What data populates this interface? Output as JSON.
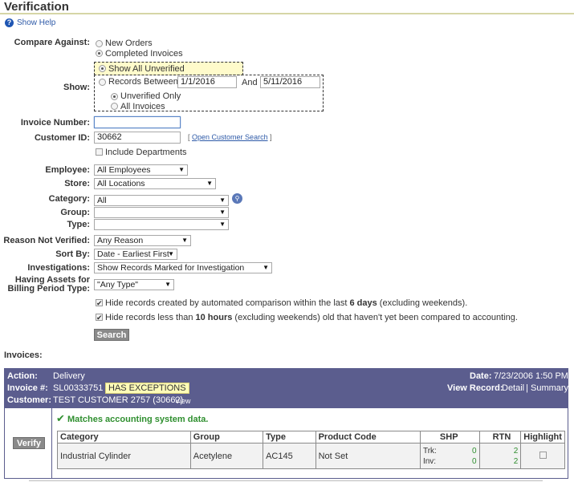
{
  "page": {
    "title": "Verification",
    "help_link": "Show Help",
    "help_icon": "question-icon"
  },
  "form": {
    "compare_label": "Compare Against:",
    "compare_options": [
      "New Orders",
      "Completed Invoices"
    ],
    "compare_selected": "Completed Invoices",
    "show_label": "Show:",
    "show_all_unverified": "Show All Unverified",
    "records_between": "Records Between:",
    "date_from": "1/1/2016",
    "date_and": "And",
    "date_to": "5/11/2016",
    "unverified_only": "Unverified Only",
    "all_invoices": "All Invoices",
    "invoice_number_label": "Invoice Number:",
    "invoice_number_value": "",
    "customer_id_label": "Customer ID:",
    "customer_id_value": "30662",
    "open_customer_search_pre": "[",
    "open_customer_search": "Open Customer Search",
    "open_customer_search_post": "]",
    "include_departments": "Include Departments",
    "employee_label": "Employee:",
    "employee_value": "All Employees",
    "store_label": "Store:",
    "store_value": "All Locations",
    "category_label": "Category:",
    "category_value": "All",
    "group_label": "Group:",
    "group_value": "",
    "type_label": "Type:",
    "type_value": "",
    "reason_label": "Reason Not Verified:",
    "reason_value": "Any Reason",
    "sort_label": "Sort By:",
    "sort_value": "Date - Earliest First",
    "investigations_label": "Investigations:",
    "investigations_value": "Show Records Marked for Investigation",
    "assets_label_1": "Having Assets for",
    "assets_label_2": "Billing Period Type:",
    "assets_value": "\"Any Type\"",
    "hide1_pre": "Hide records created by automated comparison within the last ",
    "hide1_bold": "6 days",
    "hide1_post": " (excluding weekends).",
    "hide2_pre": "Hide records less than ",
    "hide2_bold": "10 hours",
    "hide2_post": " (excluding weekends) old that haven't yet been compared to accounting.",
    "search_button": "Search"
  },
  "invoices": {
    "section_title": "Invoices:",
    "action_label": "Action:",
    "action_value": "Delivery",
    "invoice_label": "Invoice #:",
    "invoice_value": "SL00333751",
    "exceptions_badge": "HAS EXCEPTIONS",
    "customer_label": "Customer:",
    "customer_value": "TEST CUSTOMER 2757 (30662)",
    "view_link": "View",
    "date_label": "Date:",
    "date_value": "7/23/2006 1:50 PM",
    "view_record_label": "View Record:",
    "detail_link": "Detail",
    "separator": "|",
    "summary_link": "Summary",
    "verify_button": "Verify",
    "match_text": "Matches accounting system data.",
    "columns": [
      "Category",
      "Group",
      "Type",
      "Product Code",
      "SHP",
      "RTN",
      "Highlight"
    ],
    "row": {
      "category": "Industrial Cylinder",
      "group": "Acetylene",
      "type": "AC145",
      "product_code": "Not Set",
      "trk_label": "Trk:",
      "inv_label": "Inv:",
      "shp_trk": "0",
      "shp_inv": "0",
      "rtn_trk": "2",
      "rtn_inv": "2"
    }
  }
}
